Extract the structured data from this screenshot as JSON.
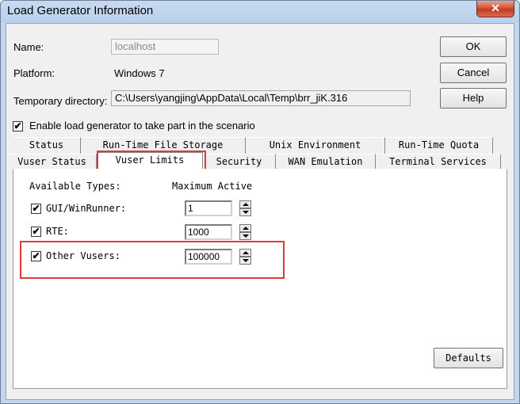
{
  "window": {
    "title": "Load Generator Information",
    "close_glyph": "✕"
  },
  "fields": {
    "name_label": "Name:",
    "name_value": "localhost",
    "platform_label": "Platform:",
    "platform_value": "Windows 7",
    "temp_dir_label": "Temporary directory:",
    "temp_dir_value": "C:\\Users\\yangjing\\AppData\\Local\\Temp\\brr_jiK.316"
  },
  "buttons": {
    "ok": "OK",
    "cancel": "Cancel",
    "help": "Help",
    "defaults": "Defaults"
  },
  "enable_checkbox": {
    "label": "Enable load generator to take part in the scenario",
    "checked": true
  },
  "tabs": {
    "row1": [
      "Status",
      "Run-Time File Storage",
      "Unix Environment",
      "Run-Time Quota"
    ],
    "row2": [
      "Vuser Status",
      "Vuser Limits",
      "Security",
      "WAN Emulation",
      "Terminal Services"
    ],
    "active": "Vuser Limits"
  },
  "vuser_limits": {
    "col_types": "Available Types:",
    "col_max": "Maximum Active",
    "rows": [
      {
        "label": "GUI/WinRunner:",
        "checked": true,
        "value": "1"
      },
      {
        "label": "RTE:",
        "checked": true,
        "value": "1000"
      },
      {
        "label": "Other Vusers:",
        "checked": true,
        "value": "100000"
      }
    ]
  },
  "colors": {
    "highlight": "#e23a3a",
    "title_bar": "#b9d0ec"
  },
  "icons": {
    "checkbox_mark": "✔"
  }
}
